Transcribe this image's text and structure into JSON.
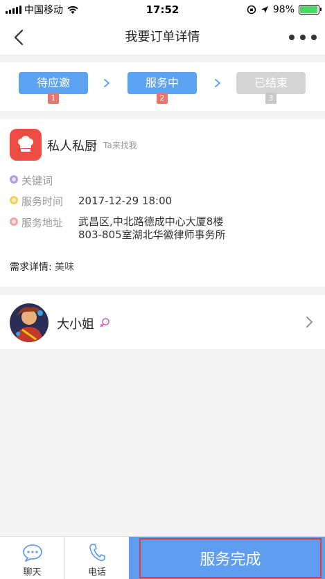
{
  "status_bar": {
    "carrier": "中国移动",
    "time": "17:52",
    "battery": "98%",
    "battery_level": 0.98
  },
  "nav": {
    "title": "我要订单详情"
  },
  "steps": [
    {
      "label": "待应邀",
      "number": "1",
      "state": "active"
    },
    {
      "label": "服务中",
      "number": "2",
      "state": "active"
    },
    {
      "label": "已结束",
      "number": "3",
      "state": "inactive"
    }
  ],
  "order": {
    "service_name": "私人私厨",
    "service_sub": "Ta来找我",
    "keyword_label": "关键词",
    "time_label": "服务时间",
    "time_value": "2017-12-29 18:00",
    "address_label": "服务地址",
    "address_value": "武昌区,中北路德成中心大厦8楼803-805室湖北华徽律师事务所",
    "requirement_label": "需求详情:",
    "requirement_value": "美味"
  },
  "user": {
    "name": "大小姐"
  },
  "bottom": {
    "chat_label": "聊天",
    "phone_label": "电话",
    "complete_label": "服务完成"
  },
  "colors": {
    "accent": "#5ba2f0",
    "step_inactive": "#d4d4d4",
    "step_num_active": "#e8766e",
    "service_icon": "#ef4c45",
    "complete_button": "#5f9df0",
    "highlight_frame": "#e33b3b"
  }
}
